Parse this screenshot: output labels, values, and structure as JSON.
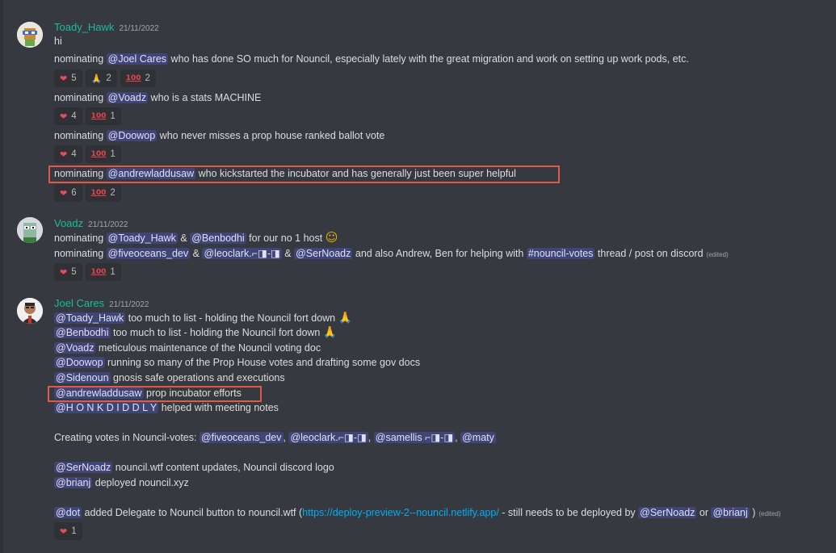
{
  "messages": [
    {
      "author": "Toady_Hawk",
      "timestamp": "21/11/2022",
      "lines": [
        "hi",
        {
          "pre": "nominating ",
          "mention": "@Joel Cares",
          "post": " who has done SO much for Nouncil, especially lately with the great migration and work on setting up work pods, etc."
        },
        {
          "pre": "nominating ",
          "mention": "@Voadz",
          "post": " who is a stats MACHINE"
        },
        {
          "pre": "nominating ",
          "mention": "@Doowop",
          "post": " who never misses a prop house ranked ballot vote"
        },
        {
          "pre": "nominating ",
          "mention": "@andrewladdusaw",
          "post": " who kickstarted the incubator and has generally just been super helpful"
        }
      ],
      "reactions": [
        [
          {
            "emoji": "heart",
            "count": "5"
          },
          {
            "emoji": "pray",
            "count": "2"
          },
          {
            "emoji": "hundred",
            "count": "2"
          }
        ],
        [
          {
            "emoji": "heart",
            "count": "4"
          },
          {
            "emoji": "hundred",
            "count": "1"
          }
        ],
        [
          {
            "emoji": "heart",
            "count": "4"
          },
          {
            "emoji": "hundred",
            "count": "1"
          }
        ],
        [
          {
            "emoji": "heart",
            "count": "6"
          },
          {
            "emoji": "hundred",
            "count": "2"
          }
        ]
      ]
    },
    {
      "author": "Voadz",
      "timestamp": "21/11/2022",
      "line1": {
        "pre": "nominating ",
        "m1": "@Toady_Hawk",
        "amp": " & ",
        "m2": "@Benbodhi",
        "post": "  for our no 1 host"
      },
      "line2": {
        "pre": "nominating ",
        "m1": "@fiveoceans_dev",
        "amp1": " & ",
        "m2": "@leoclark.⌐◨-◨",
        "amp2": "  & ",
        "m3": "@SerNoadz",
        "mid": "  and also Andrew, Ben for helping with ",
        "channel": "nouncil-votes",
        "post": " thread / post on discord",
        "edited": "(edited)"
      },
      "reactions": [
        {
          "emoji": "heart",
          "count": "5"
        },
        {
          "emoji": "hundred",
          "count": "1"
        }
      ]
    },
    {
      "author": "Joel Cares",
      "timestamp": "21/11/2022",
      "lines": [
        {
          "mention": "@Toady_Hawk",
          "post": " too much to list - holding the Nouncil fort down"
        },
        {
          "mention": "@Benbodhi",
          "post": " too much to list - holding the Nouncil fort down"
        },
        {
          "mention": "@Voadz",
          "post": " meticulous maintenance of the Nouncil voting doc"
        },
        {
          "mention": "@Doowop",
          "post": " running so many of the Prop House votes and drafting some gov docs"
        },
        {
          "mention": "@Sidenoun",
          "post": " gnosis safe operations and executions"
        },
        {
          "mention": "@andrewladdusaw",
          "post": " prop incubator efforts"
        },
        {
          "mention": "@H O N K D I D D L Y",
          "post": " helped with meeting notes"
        }
      ],
      "votes_line": {
        "pre": "Creating votes in Nouncil-votes: ",
        "m1": "@fiveoceans_dev",
        "c1": ", ",
        "m2": "@leoclark.⌐◨-◨",
        "c2": ", ",
        "m3": "@samellis ⌐◨-◨",
        "c3": ", ",
        "m4": "@maty"
      },
      "sernoadz_line": {
        "mention": "@SerNoadz",
        "post": " nouncil.wtf content updates, Nouncil discord logo"
      },
      "brianj_line": {
        "mention": "@brianj",
        "post": " deployed nouncil.xyz"
      },
      "dot_line": {
        "mention": "@dot",
        "pre": " added Delegate to Nouncil button to nouncil.wtf (",
        "link": "https://deploy-preview-2--nouncil.netlify.app/",
        "mid": " - still needs to be deployed by ",
        "m2": "@SerNoadz",
        "or": " or ",
        "m3": "@brianj",
        "close": " )",
        "edited": "(edited)"
      },
      "reactions": [
        {
          "emoji": "heart",
          "count": "1"
        }
      ]
    }
  ],
  "icons": {
    "heart": "heart-emoji-icon",
    "pray": "pray-emoji-icon",
    "hundred": "hundred-emoji-icon",
    "channel": "hash-channel-icon"
  },
  "colors": {
    "background": "#36393f",
    "username": "#1abc9c",
    "mention_bg": "#5865f2",
    "link": "#00aff4",
    "highlight_box": "#e05a47"
  }
}
